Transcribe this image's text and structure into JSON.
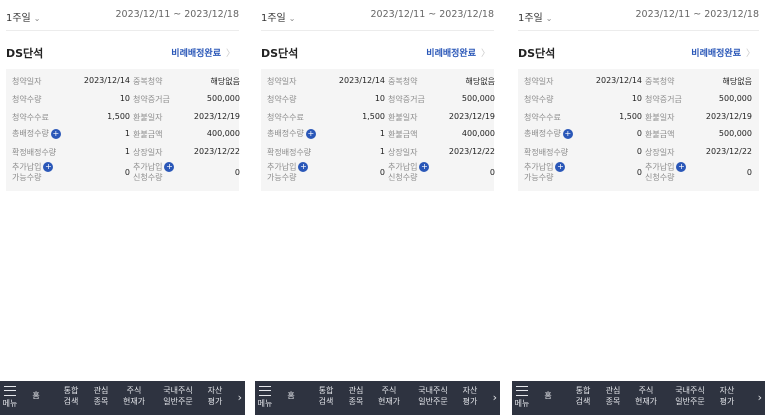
{
  "panels": [
    {
      "period": "1주일",
      "range": "2023/12/11 ~ 2023/12/18",
      "title": "DS단석",
      "status": "비례배정완료",
      "fields": {
        "sub_date_label": "청약일자",
        "sub_date": "2023/12/14",
        "sub_qty_label": "청약수량",
        "sub_qty": "10",
        "fee_label": "청약수수료",
        "fee": "1,500",
        "total_alloc_label": "총배정수량",
        "total_alloc": "1",
        "confirm_alloc_label": "확정배정수량",
        "confirm_alloc": "1",
        "add_pay_label_1": "추가납입",
        "add_pay_label_2": "가능수량",
        "add_pay": "0",
        "dup_label": "중복청약",
        "dup": "해당없음",
        "deposit_label": "청약증거금",
        "deposit": "500,000",
        "refund_date_label": "환불일자",
        "refund_date": "2023/12/19",
        "refund_amt_label": "환불금액",
        "refund_amt": "400,000",
        "listing_label": "상장일자",
        "listing": "2023/12/22",
        "add_req_label_1": "추가납입",
        "add_req_label_2": "신청수량",
        "add_req": "0"
      }
    },
    {
      "period": "1주일",
      "range": "2023/12/11 ~ 2023/12/18",
      "title": "DS단석",
      "status": "비례배정완료",
      "fields": {
        "sub_date_label": "청약일자",
        "sub_date": "2023/12/14",
        "sub_qty_label": "청약수량",
        "sub_qty": "10",
        "fee_label": "청약수수료",
        "fee": "1,500",
        "total_alloc_label": "총배정수량",
        "total_alloc": "1",
        "confirm_alloc_label": "확정배정수량",
        "confirm_alloc": "1",
        "add_pay_label_1": "추가납입",
        "add_pay_label_2": "가능수량",
        "add_pay": "0",
        "dup_label": "중복청약",
        "dup": "해당없음",
        "deposit_label": "청약증거금",
        "deposit": "500,000",
        "refund_date_label": "환불일자",
        "refund_date": "2023/12/19",
        "refund_amt_label": "환불금액",
        "refund_amt": "400,000",
        "listing_label": "상장일자",
        "listing": "2023/12/22",
        "add_req_label_1": "추가납입",
        "add_req_label_2": "신청수량",
        "add_req": "0"
      }
    },
    {
      "period": "1주일",
      "range": "2023/12/11 ~ 2023/12/18",
      "title": "DS단석",
      "status": "비례배정완료",
      "fields": {
        "sub_date_label": "청약일자",
        "sub_date": "2023/12/14",
        "sub_qty_label": "청약수량",
        "sub_qty": "10",
        "fee_label": "청약수수료",
        "fee": "1,500",
        "total_alloc_label": "총배정수량",
        "total_alloc": "0",
        "confirm_alloc_label": "확정배정수량",
        "confirm_alloc": "0",
        "add_pay_label_1": "추가납입",
        "add_pay_label_2": "가능수량",
        "add_pay": "0",
        "dup_label": "중복청약",
        "dup": "해당없음",
        "deposit_label": "청약증거금",
        "deposit": "500,000",
        "refund_date_label": "환불일자",
        "refund_date": "2023/12/19",
        "refund_amt_label": "환불금액",
        "refund_amt": "500,000",
        "listing_label": "상장일자",
        "listing": "2023/12/22",
        "add_req_label_1": "추가납입",
        "add_req_label_2": "신청수량",
        "add_req": "0"
      }
    }
  ],
  "nav": {
    "menu": "메뉴",
    "home": "홈",
    "search_1": "통합",
    "search_2": "검색",
    "watch_1": "관심",
    "watch_2": "종목",
    "price_1": "주식",
    "price_2": "현재가",
    "order_1": "국내주식",
    "order_2": "일반주문",
    "asset_1": "자산",
    "asset_2": "평가"
  },
  "colors": {
    "accent": "#2a57b8",
    "nav_bg": "#2e3340",
    "card_bg": "#f5f5f5"
  }
}
